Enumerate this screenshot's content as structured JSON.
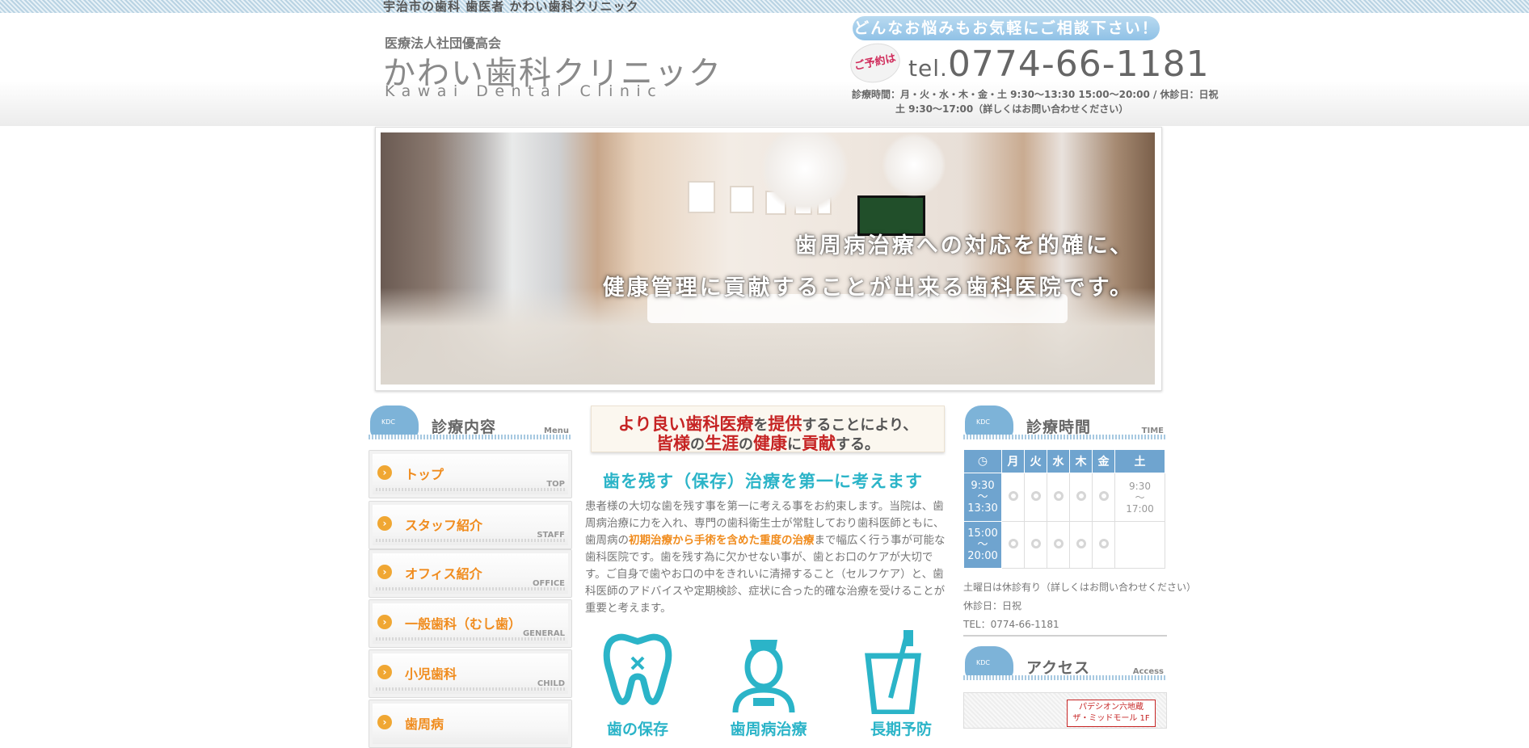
{
  "topbar": {
    "text": "宇治市の歯科 歯医者 かわい歯科クリニック"
  },
  "header": {
    "corporation": "医療法人社団優高会",
    "clinic_name": "かわい歯科クリニック",
    "clinic_name_en": "Kawai Dental Clinic",
    "consult_banner": "どんなお悩みもお気軽にご相談下さい！",
    "reserve_badge": "ご予約は",
    "tel_prefix": "tel.",
    "tel_number": "0774-66-1181",
    "hours_line1": "診療時間：月・火・水・木・金・土 9:30〜13:30 15:00〜20:00 / 休診日：日祝",
    "hours_line2": "土 9:30〜17:00（詳しくはお問い合わせください）"
  },
  "hero": {
    "line1": "歯周病治療への対応を的確に、",
    "line2": "健康管理に貢献することが出来る歯科医院です。"
  },
  "menu": {
    "title": "診療内容",
    "subtitle": "Menu",
    "mascot_text": "KDC",
    "items": [
      {
        "label": "トップ",
        "en": "TOP"
      },
      {
        "label": "スタッフ紹介",
        "en": "STAFF"
      },
      {
        "label": "オフィス紹介",
        "en": "OFFICE"
      },
      {
        "label": "一般歯科（むし歯）",
        "en": "GENERAL"
      },
      {
        "label": "小児歯科",
        "en": "CHILD"
      },
      {
        "label": "歯周病",
        "en": ""
      }
    ]
  },
  "main": {
    "catch_l1_a": "より良い歯科医療",
    "catch_l1_b": "を",
    "catch_l1_c": "提供",
    "catch_l1_d": "することにより、",
    "catch_l2_a": "皆様",
    "catch_l2_b": "の",
    "catch_l2_c": "生涯",
    "catch_l2_d": "の",
    "catch_l2_e": "健康",
    "catch_l2_f": "に",
    "catch_l2_g": "貢献",
    "catch_l2_h": "する。",
    "headline": "歯を残す（保存）治療を第一に考えます",
    "para_1": "患者様の大切な歯を残す事を第一に考える事をお約束します。当院は、歯周病治療に力を入れ、専門の歯科衛生士が常駐しており歯科医師ともに、歯周病の",
    "para_hl": "初期治療から手術を含めた重度の治療",
    "para_2": "まで幅広く行う事が可能な歯科医院です。歯を残す為に欠かせない事が、歯とお口のケアが大切です。ご自身で歯やお口の中をきれいに清掃すること（セルフケア）と、歯科医師のアドバイスや定期検診、症状に合った的確な治療を受けることが重要と考えます。",
    "features": [
      {
        "label": "歯の保存",
        "icon": "tooth-icon"
      },
      {
        "label": "歯周病治療",
        "icon": "hygienist-icon"
      },
      {
        "label": "長期予防",
        "icon": "toothbrush-cup-icon"
      }
    ]
  },
  "time": {
    "title": "診療時間",
    "subtitle": "TIME",
    "mascot_text": "KDC",
    "days": [
      "月",
      "火",
      "水",
      "木",
      "金",
      "土"
    ],
    "clock_icon": "clock-icon",
    "slot1_a": "9:30",
    "slot1_b": "〜",
    "slot1_c": "13:30",
    "slot2_a": "15:00",
    "slot2_b": "〜",
    "slot2_c": "20:00",
    "sat1_a": "9:30",
    "sat1_b": "〜",
    "sat1_c": "17:00",
    "note1": "土曜日は休診有り（詳しくはお問い合わせください）",
    "note2": "休診日：日祝",
    "note3": "TEL：0774-66-1181"
  },
  "access": {
    "title": "アクセス",
    "subtitle": "Access",
    "mascot_text": "KDC",
    "map_tag_l1": "パデシオン六地蔵",
    "map_tag_l2": "ザ・ミッドモール 1F"
  },
  "colors": {
    "accent_blue": "#6fa4cf",
    "accent_orange": "#f08c1e",
    "accent_teal": "#2bb4c8",
    "accent_red": "#c62424"
  }
}
